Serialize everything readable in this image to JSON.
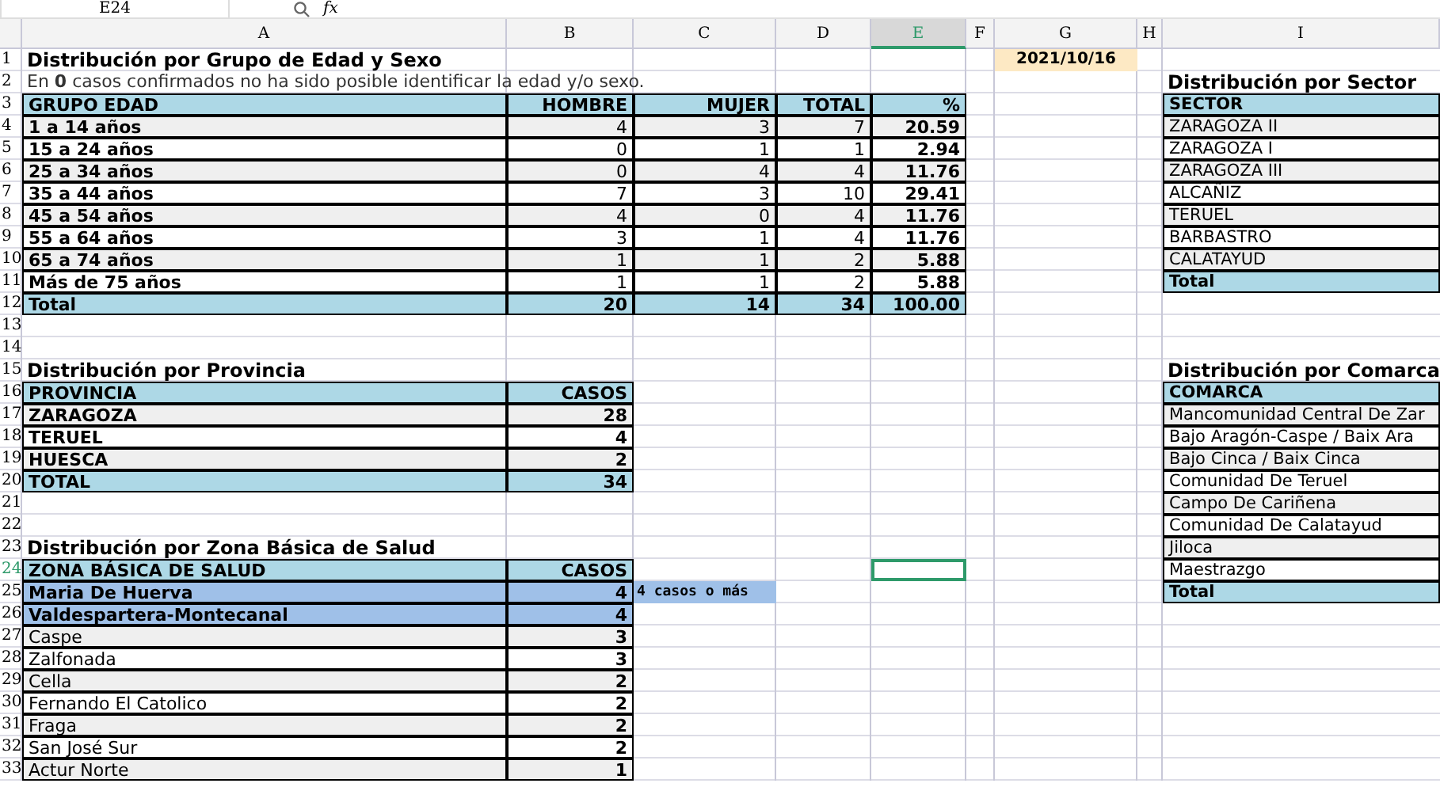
{
  "formula_bar": {
    "name_box": "E24",
    "function_label": "fx"
  },
  "column_headers": [
    {
      "label": "A",
      "selected": false
    },
    {
      "label": "B",
      "selected": false
    },
    {
      "label": "C",
      "selected": false
    },
    {
      "label": "D",
      "selected": false
    },
    {
      "label": "E",
      "selected": true
    },
    {
      "label": "F",
      "selected": false
    },
    {
      "label": "G",
      "selected": false
    },
    {
      "label": "H",
      "selected": false
    },
    {
      "label": "I",
      "selected": false
    }
  ],
  "row_headers": [
    {
      "label": "1",
      "selected": false
    },
    {
      "label": "2",
      "selected": false
    },
    {
      "label": "3",
      "selected": false
    },
    {
      "label": "4",
      "selected": false
    },
    {
      "label": "5",
      "selected": false
    },
    {
      "label": "6",
      "selected": false
    },
    {
      "label": "7",
      "selected": false
    },
    {
      "label": "8",
      "selected": false
    },
    {
      "label": "9",
      "selected": false
    },
    {
      "label": "10",
      "selected": false
    },
    {
      "label": "11",
      "selected": false
    },
    {
      "label": "12",
      "selected": false
    },
    {
      "label": "13",
      "selected": false
    },
    {
      "label": "14",
      "selected": false
    },
    {
      "label": "15",
      "selected": false
    },
    {
      "label": "16",
      "selected": false
    },
    {
      "label": "17",
      "selected": false
    },
    {
      "label": "18",
      "selected": false
    },
    {
      "label": "19",
      "selected": false
    },
    {
      "label": "20",
      "selected": false
    },
    {
      "label": "21",
      "selected": false
    },
    {
      "label": "22",
      "selected": false
    },
    {
      "label": "23",
      "selected": false
    },
    {
      "label": "24",
      "selected": true
    },
    {
      "label": "25",
      "selected": false
    },
    {
      "label": "26",
      "selected": false
    },
    {
      "label": "27",
      "selected": false
    },
    {
      "label": "28",
      "selected": false
    },
    {
      "label": "29",
      "selected": false
    },
    {
      "label": "30",
      "selected": false
    },
    {
      "label": "31",
      "selected": false
    },
    {
      "label": "32",
      "selected": false
    },
    {
      "label": "33",
      "selected": false
    }
  ],
  "date": "2021/10/16",
  "age_table": {
    "title": "Distribución por Grupo de Edad y Sexo",
    "note": "En **0** casos confirmados no ha sido posible identificar la edad y/o sexo.",
    "columns": [
      "GRUPO EDAD",
      "HOMBRE",
      "MUJER",
      "TOTAL",
      "%"
    ],
    "rows": [
      [
        "1 a 14 años",
        "4",
        "3",
        "7",
        "20.59"
      ],
      [
        "15 a 24 años",
        "0",
        "1",
        "1",
        "2.94"
      ],
      [
        "25 a 34 años",
        "0",
        "4",
        "4",
        "11.76"
      ],
      [
        "35 a 44 años",
        "7",
        "3",
        "10",
        "29.41"
      ],
      [
        "45 a 54 años",
        "4",
        "0",
        "4",
        "11.76"
      ],
      [
        "55 a 64 años",
        "3",
        "1",
        "4",
        "11.76"
      ],
      [
        "65 a 74 años",
        "1",
        "1",
        "2",
        "5.88"
      ],
      [
        "Más de 75 años",
        "1",
        "1",
        "2",
        "5.88"
      ]
    ],
    "total": [
      "Total",
      "20",
      "14",
      "34",
      "100.00"
    ]
  },
  "province_table": {
    "title": "Distribución por Provincia",
    "columns": [
      "PROVINCIA",
      "CASOS"
    ],
    "rows": [
      [
        "ZARAGOZA",
        "28"
      ],
      [
        "TERUEL",
        "4"
      ],
      [
        "HUESCA",
        "2"
      ]
    ],
    "total": [
      "TOTAL",
      "34"
    ]
  },
  "zone_table": {
    "title": "Distribución por Zona Básica de Salud",
    "columns": [
      "ZONA BÁSICA DE SALUD",
      "CASOS"
    ],
    "legend": "4 casos o más",
    "rows": [
      {
        "name": "Maria De Huerva",
        "cases": "4",
        "highlighted": true
      },
      {
        "name": "Valdespartera-Montecanal",
        "cases": "4",
        "highlighted": true
      },
      {
        "name": "Caspe",
        "cases": "3",
        "highlighted": false
      },
      {
        "name": "Zalfonada",
        "cases": "3",
        "highlighted": false
      },
      {
        "name": "Cella",
        "cases": "2",
        "highlighted": false
      },
      {
        "name": "Fernando El Catolico",
        "cases": "2",
        "highlighted": false
      },
      {
        "name": "Fraga",
        "cases": "2",
        "highlighted": false
      },
      {
        "name": "San José Sur",
        "cases": "2",
        "highlighted": false
      },
      {
        "name": "Actur Norte",
        "cases": "1",
        "highlighted": false
      }
    ]
  },
  "sector_table": {
    "title": "Distribución por Sector",
    "column": "SECTOR",
    "rows": [
      "ZARAGOZA II",
      "ZARAGOZA I",
      "ZARAGOZA III",
      "ALCAÑIZ",
      "TERUEL",
      "BARBASTRO",
      "CALATAYUD"
    ],
    "total": "Total"
  },
  "comarca_table": {
    "title": "Distribución por Comarca",
    "column": "COMARCA",
    "rows": [
      "Mancomunidad Central De Zar",
      "Bajo Aragón-Caspe / Baix Ara",
      "Bajo Cinca / Baix Cinca",
      "Comunidad De Teruel",
      "Campo De Cariñena",
      "Comunidad De Calatayud",
      "Jiloca",
      "Maestrazgo"
    ],
    "total": "Total"
  }
}
